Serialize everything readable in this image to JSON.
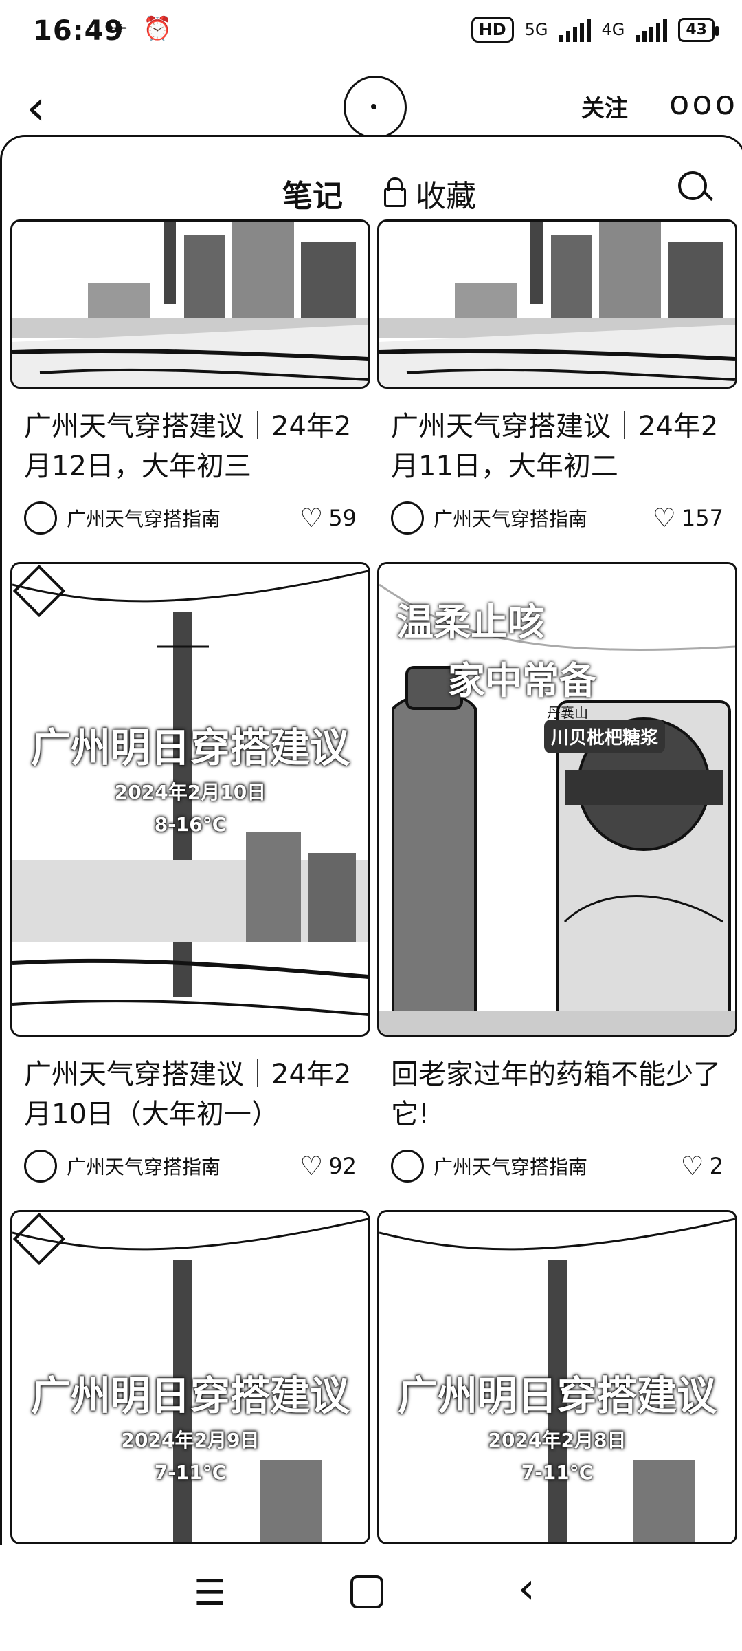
{
  "status_bar": {
    "time": "16:49",
    "hd": "HD",
    "network_5g": "5G",
    "network_4g": "4G",
    "battery": "43"
  },
  "header": {
    "follow_label": "关注",
    "more_label": "ooo"
  },
  "tabs": {
    "notes_label": "笔记",
    "favorites_label": "收藏"
  },
  "cards": [
    {
      "title": "广州天气穿搭建议｜24年2月12日，大年初三",
      "author": "广州天气穿搭指南",
      "likes": "59"
    },
    {
      "title": "广州天气穿搭建议｜24年2月11日，大年初二",
      "author": "广州天气穿搭指南",
      "likes": "157"
    },
    {
      "title": "广州天气穿搭建议｜24年2月10日（大年初一）",
      "author": "广州天气穿搭指南",
      "likes": "92",
      "poster": {
        "main": "广州明日穿搭建议",
        "date": "2024年2月10日",
        "temp": "8-16°C"
      }
    },
    {
      "title": "回老家过年的药箱不能少了它!",
      "author": "广州天气穿搭指南",
      "likes": "2",
      "ad": {
        "line1": "温柔止咳",
        "line2": "家中常备",
        "brand": "丹襄山",
        "product": "川贝枇杷糖浆"
      }
    },
    {
      "poster": {
        "main": "广州明日穿搭建议",
        "date": "2024年2月9日",
        "temp": "7-11°C"
      }
    },
    {
      "poster": {
        "main": "广州明日穿搭建议",
        "date": "2024年2月8日",
        "temp": "7-11°C"
      }
    }
  ],
  "nav_bar": {
    "menu_icon": "menu-icon",
    "home_icon": "home-icon",
    "back_icon": "back-icon"
  }
}
